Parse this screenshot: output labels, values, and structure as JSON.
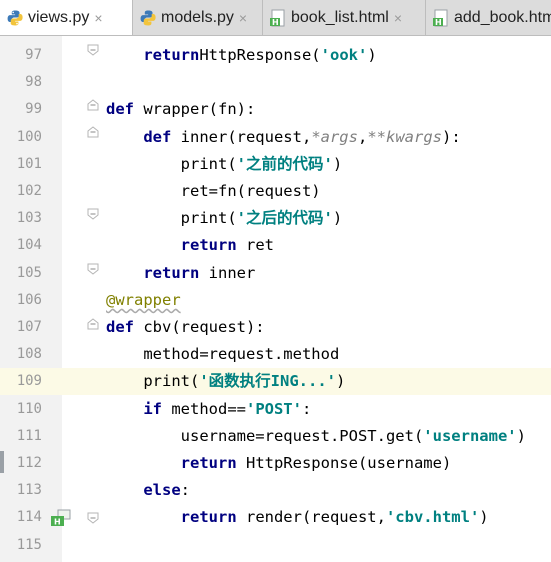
{
  "tabs": [
    {
      "label": "views.py",
      "icon": "python-file-icon",
      "active": true,
      "close": "×"
    },
    {
      "label": "models.py",
      "icon": "python-file-icon",
      "active": false,
      "close": "×"
    },
    {
      "label": "book_list.html",
      "icon": "html-file-icon",
      "active": false,
      "close": "×"
    },
    {
      "label": "add_book.html",
      "icon": "html-file-icon",
      "active": false,
      "close": ""
    }
  ],
  "editor": {
    "current_line": "109",
    "lines": [
      {
        "n": "97",
        "indent": "    ",
        "tokens": [
          [
            "kw",
            "return"
          ],
          [
            "",
            "HttpResponse("
          ],
          [
            "st",
            "'ook'"
          ],
          [
            "",
            ")"
          ]
        ]
      },
      {
        "n": "98",
        "indent": "",
        "tokens": []
      },
      {
        "n": "99",
        "indent": "",
        "tokens": [
          [
            "kw",
            "def "
          ],
          [
            "",
            "wrapper(fn):"
          ]
        ]
      },
      {
        "n": "100",
        "indent": "    ",
        "tokens": [
          [
            "kw",
            "def "
          ],
          [
            "",
            "inner(request,"
          ],
          [
            "pm",
            "*args"
          ],
          [
            "",
            ","
          ],
          [
            "pm",
            "**kwargs"
          ],
          [
            "",
            "):"
          ]
        ]
      },
      {
        "n": "101",
        "indent": "        ",
        "tokens": [
          [
            "",
            "print("
          ],
          [
            "st",
            "'之前的代码'"
          ],
          [
            "",
            ")"
          ]
        ]
      },
      {
        "n": "102",
        "indent": "        ",
        "tokens": [
          [
            "",
            "ret=fn(request)"
          ]
        ]
      },
      {
        "n": "103",
        "indent": "        ",
        "tokens": [
          [
            "",
            "print("
          ],
          [
            "st",
            "'之后的代码'"
          ],
          [
            "",
            ")"
          ]
        ]
      },
      {
        "n": "104",
        "indent": "        ",
        "tokens": [
          [
            "kw",
            "return "
          ],
          [
            "",
            "ret"
          ]
        ]
      },
      {
        "n": "105",
        "indent": "    ",
        "tokens": [
          [
            "kw",
            "return "
          ],
          [
            "",
            "inner"
          ]
        ]
      },
      {
        "n": "106",
        "indent": "",
        "tokens": [
          [
            "dec",
            "@wrapper"
          ]
        ]
      },
      {
        "n": "107",
        "indent": "",
        "tokens": [
          [
            "kw",
            "def "
          ],
          [
            "",
            "cbv(request):"
          ]
        ]
      },
      {
        "n": "108",
        "indent": "    ",
        "tokens": [
          [
            "",
            "method=request.method"
          ]
        ]
      },
      {
        "n": "109",
        "indent": "    ",
        "tokens": [
          [
            "",
            "print("
          ],
          [
            "st",
            "'函数执行ING...'"
          ],
          [
            "",
            ")"
          ]
        ]
      },
      {
        "n": "110",
        "indent": "    ",
        "tokens": [
          [
            "kw",
            "if "
          ],
          [
            "",
            "method=="
          ],
          [
            "st",
            "'POST'"
          ],
          [
            "",
            ":"
          ]
        ]
      },
      {
        "n": "111",
        "indent": "        ",
        "tokens": [
          [
            "",
            "username=request.POST.get("
          ],
          [
            "st",
            "'username'"
          ],
          [
            "",
            ")"
          ]
        ]
      },
      {
        "n": "112",
        "indent": "        ",
        "tokens": [
          [
            "kw",
            "return "
          ],
          [
            "",
            "HttpResponse(username)"
          ]
        ]
      },
      {
        "n": "113",
        "indent": "    ",
        "tokens": [
          [
            "kw",
            "else"
          ],
          [
            "",
            ":"
          ]
        ]
      },
      {
        "n": "114",
        "indent": "        ",
        "tokens": [
          [
            "kw",
            "return "
          ],
          [
            "",
            "render(request,"
          ],
          [
            "st",
            "'cbv.html'"
          ],
          [
            "",
            ")"
          ]
        ]
      },
      {
        "n": "115",
        "indent": "",
        "tokens": []
      }
    ]
  },
  "colors": {
    "keyword": "#000080",
    "string": "#008080",
    "param": "#808080",
    "decorator": "#808000",
    "current_line": "#fcfae6"
  }
}
